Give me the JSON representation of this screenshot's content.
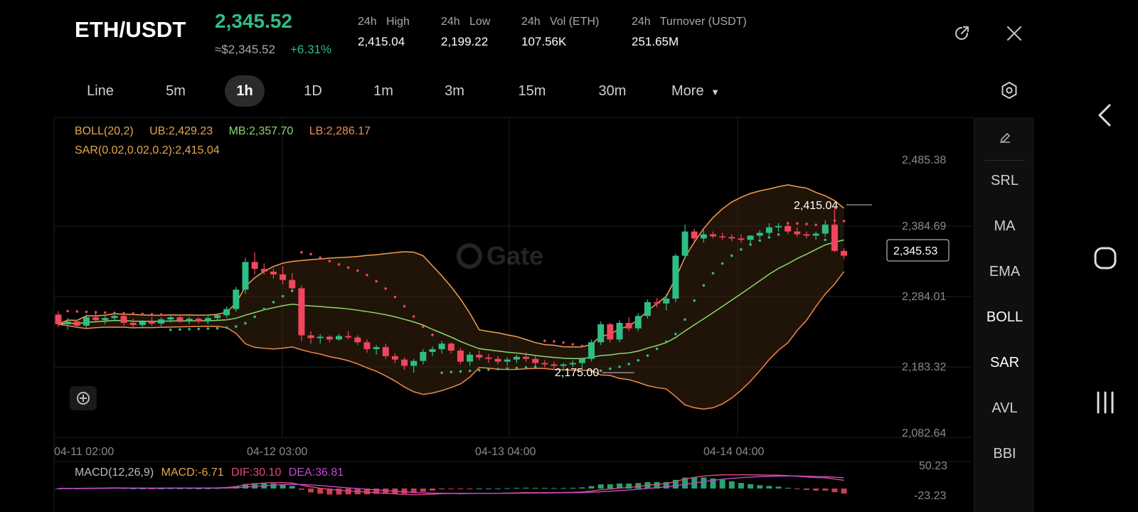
{
  "header": {
    "pair": "ETH/USDT",
    "price": "2,345.52",
    "usd_approx": "≈$2,345.52",
    "change": "+6.31%",
    "stats": [
      {
        "label": "24h   High",
        "value": "2,415.04"
      },
      {
        "label": "24h   Low",
        "value": "2,199.22"
      },
      {
        "label": "24h   Vol (ETH)",
        "value": "107.56K"
      },
      {
        "label": "24h   Turnover (USDT)",
        "value": "251.65M"
      }
    ],
    "icons": {
      "share": "share-icon",
      "close": "close-icon"
    }
  },
  "timeframes": {
    "items": [
      "Line",
      "5m",
      "1h",
      "1D",
      "1m",
      "3m",
      "15m",
      "30m",
      "More"
    ],
    "active": "1h",
    "settings_icon": "hexagon-settings-icon"
  },
  "indicators": {
    "boll": {
      "name": "BOLL(20,2)",
      "ub": "UB:2,429.23",
      "mb": "MB:2,357.70",
      "lb": "LB:2,286.17"
    },
    "sar": "SAR(0.02,0.02,0.2):2,415.04",
    "macd": {
      "name": "MACD(12,26,9)",
      "macd": "MACD:-6.71",
      "dif": "DIF:30.10",
      "dea": "DEA:36.81"
    }
  },
  "side_panel": {
    "items": [
      "SRL",
      "MA",
      "EMA",
      "BOLL",
      "SAR",
      "AVL",
      "BBI"
    ],
    "active": [
      "BOLL",
      "SAR"
    ],
    "edit_icon": "pencil-icon"
  },
  "watermark": "Gate",
  "chart_data": {
    "type": "candlestick",
    "y_ticks": [
      "2,485.38",
      "2,384.69",
      "2,284.01",
      "2,183.32",
      "2,082.64"
    ],
    "x_ticks": [
      "04-11 02:00",
      "04-12 03:00",
      "04-13 04:00",
      "04-14 04:00"
    ],
    "annotations": {
      "high": "2,415.04",
      "low": "2,175.00",
      "last": "2,345.53"
    },
    "macd_ticks": [
      "50.23",
      "-23.23"
    ],
    "ylim": [
      2082.64,
      2485.38
    ],
    "candles": [
      [
        2260,
        2265,
        2242,
        2246
      ],
      [
        2246,
        2255,
        2238,
        2250
      ],
      [
        2250,
        2252,
        2241,
        2244
      ],
      [
        2244,
        2260,
        2240,
        2256
      ],
      [
        2256,
        2262,
        2248,
        2252
      ],
      [
        2252,
        2258,
        2246,
        2255
      ],
      [
        2255,
        2262,
        2250,
        2258
      ],
      [
        2258,
        2260,
        2244,
        2248
      ],
      [
        2248,
        2254,
        2240,
        2245
      ],
      [
        2245,
        2252,
        2241,
        2250
      ],
      [
        2250,
        2256,
        2244,
        2247
      ],
      [
        2247,
        2256,
        2243,
        2253
      ],
      [
        2253,
        2260,
        2248,
        2256
      ],
      [
        2256,
        2258,
        2248,
        2251
      ],
      [
        2251,
        2257,
        2246,
        2254
      ],
      [
        2254,
        2256,
        2247,
        2250
      ],
      [
        2250,
        2258,
        2246,
        2255
      ],
      [
        2255,
        2262,
        2251,
        2259
      ],
      [
        2259,
        2272,
        2255,
        2268
      ],
      [
        2268,
        2300,
        2264,
        2296
      ],
      [
        2296,
        2342,
        2290,
        2336
      ],
      [
        2336,
        2350,
        2318,
        2326
      ],
      [
        2326,
        2334,
        2318,
        2322
      ],
      [
        2322,
        2326,
        2312,
        2318
      ],
      [
        2318,
        2330,
        2304,
        2310
      ],
      [
        2310,
        2320,
        2296,
        2298
      ],
      [
        2298,
        2302,
        2222,
        2230
      ],
      [
        2230,
        2236,
        2218,
        2226
      ],
      [
        2226,
        2232,
        2218,
        2228
      ],
      [
        2228,
        2230,
        2220,
        2224
      ],
      [
        2224,
        2232,
        2222,
        2229
      ],
      [
        2229,
        2236,
        2224,
        2227
      ],
      [
        2227,
        2230,
        2216,
        2220
      ],
      [
        2220,
        2224,
        2205,
        2210
      ],
      [
        2210,
        2216,
        2202,
        2213
      ],
      [
        2213,
        2218,
        2196,
        2200
      ],
      [
        2200,
        2204,
        2190,
        2195
      ],
      [
        2195,
        2198,
        2180,
        2186
      ],
      [
        2186,
        2196,
        2176,
        2193
      ],
      [
        2193,
        2210,
        2188,
        2206
      ],
      [
        2206,
        2214,
        2200,
        2210
      ],
      [
        2210,
        2222,
        2204,
        2218
      ],
      [
        2218,
        2220,
        2204,
        2208
      ],
      [
        2208,
        2212,
        2188,
        2192
      ],
      [
        2192,
        2206,
        2186,
        2202
      ],
      [
        2202,
        2208,
        2194,
        2198
      ],
      [
        2198,
        2203,
        2190,
        2196
      ],
      [
        2196,
        2200,
        2188,
        2192
      ],
      [
        2192,
        2198,
        2186,
        2195
      ],
      [
        2195,
        2202,
        2190,
        2199
      ],
      [
        2199,
        2205,
        2192,
        2196
      ],
      [
        2196,
        2200,
        2186,
        2190
      ],
      [
        2190,
        2194,
        2184,
        2188
      ],
      [
        2188,
        2192,
        2180,
        2186
      ],
      [
        2186,
        2190,
        2178,
        2188
      ],
      [
        2188,
        2194,
        2184,
        2190
      ],
      [
        2190,
        2198,
        2182,
        2196
      ],
      [
        2196,
        2224,
        2192,
        2220
      ],
      [
        2220,
        2250,
        2216,
        2246
      ],
      [
        2246,
        2248,
        2220,
        2224
      ],
      [
        2224,
        2252,
        2220,
        2248
      ],
      [
        2248,
        2256,
        2236,
        2240
      ],
      [
        2240,
        2262,
        2236,
        2258
      ],
      [
        2258,
        2282,
        2254,
        2278
      ],
      [
        2278,
        2284,
        2270,
        2276
      ],
      [
        2276,
        2290,
        2266,
        2283
      ],
      [
        2283,
        2348,
        2278,
        2345
      ],
      [
        2345,
        2390,
        2340,
        2380
      ],
      [
        2380,
        2384,
        2366,
        2370
      ],
      [
        2370,
        2382,
        2364,
        2376
      ],
      [
        2376,
        2380,
        2370,
        2373
      ],
      [
        2373,
        2378,
        2368,
        2372
      ],
      [
        2372,
        2376,
        2366,
        2370
      ],
      [
        2370,
        2376,
        2364,
        2368
      ],
      [
        2368,
        2375,
        2362,
        2374
      ],
      [
        2374,
        2382,
        2370,
        2378
      ],
      [
        2378,
        2392,
        2374,
        2386
      ],
      [
        2386,
        2392,
        2380,
        2388
      ],
      [
        2388,
        2390,
        2376,
        2380
      ],
      [
        2380,
        2386,
        2372,
        2376
      ],
      [
        2376,
        2380,
        2370,
        2374
      ],
      [
        2374,
        2380,
        2368,
        2377
      ],
      [
        2377,
        2396,
        2372,
        2390
      ],
      [
        2390,
        2415,
        2350,
        2352
      ],
      [
        2352,
        2356,
        2340,
        2345
      ]
    ]
  },
  "nav": {
    "back": "back-icon",
    "home": "home-icon",
    "recents": "recents-icon"
  }
}
